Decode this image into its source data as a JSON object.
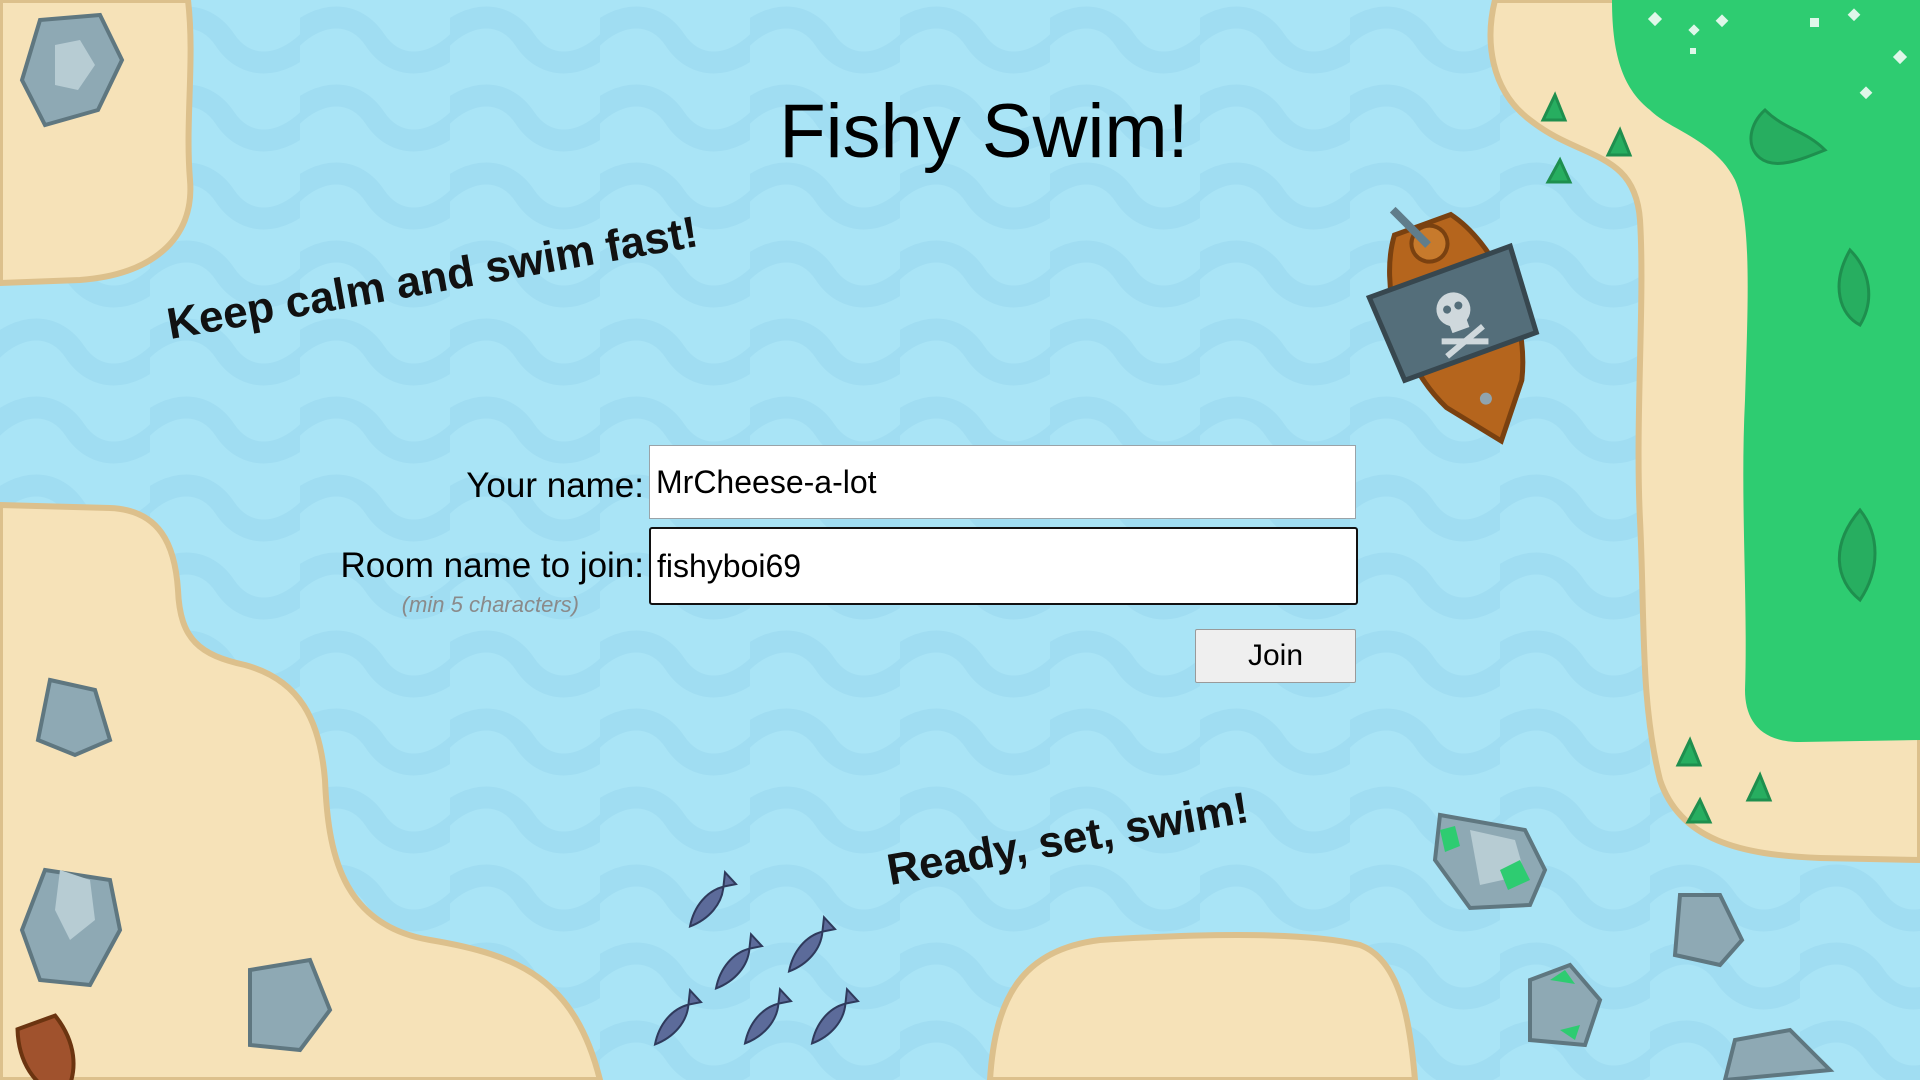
{
  "game": {
    "title": "Fishy Swim!",
    "slogan_top": "Keep calm and swim fast!",
    "slogan_bottom": "Ready, set, swim!"
  },
  "form": {
    "name_label": "Your name:",
    "name_value": "MrCheese-a-lot",
    "room_label": "Room name to join:",
    "room_hint": "(min 5 characters)",
    "room_value": "fishyboi69",
    "join_label": "Join"
  },
  "colors": {
    "water": "#a9e4f6",
    "wave": "#9ad8ee",
    "sand": "#f6e2b8",
    "sand_edge": "#dcc08c",
    "grass": "#2ecc71",
    "rock": "#8ea9b4",
    "rock_dark": "#5f7780"
  }
}
